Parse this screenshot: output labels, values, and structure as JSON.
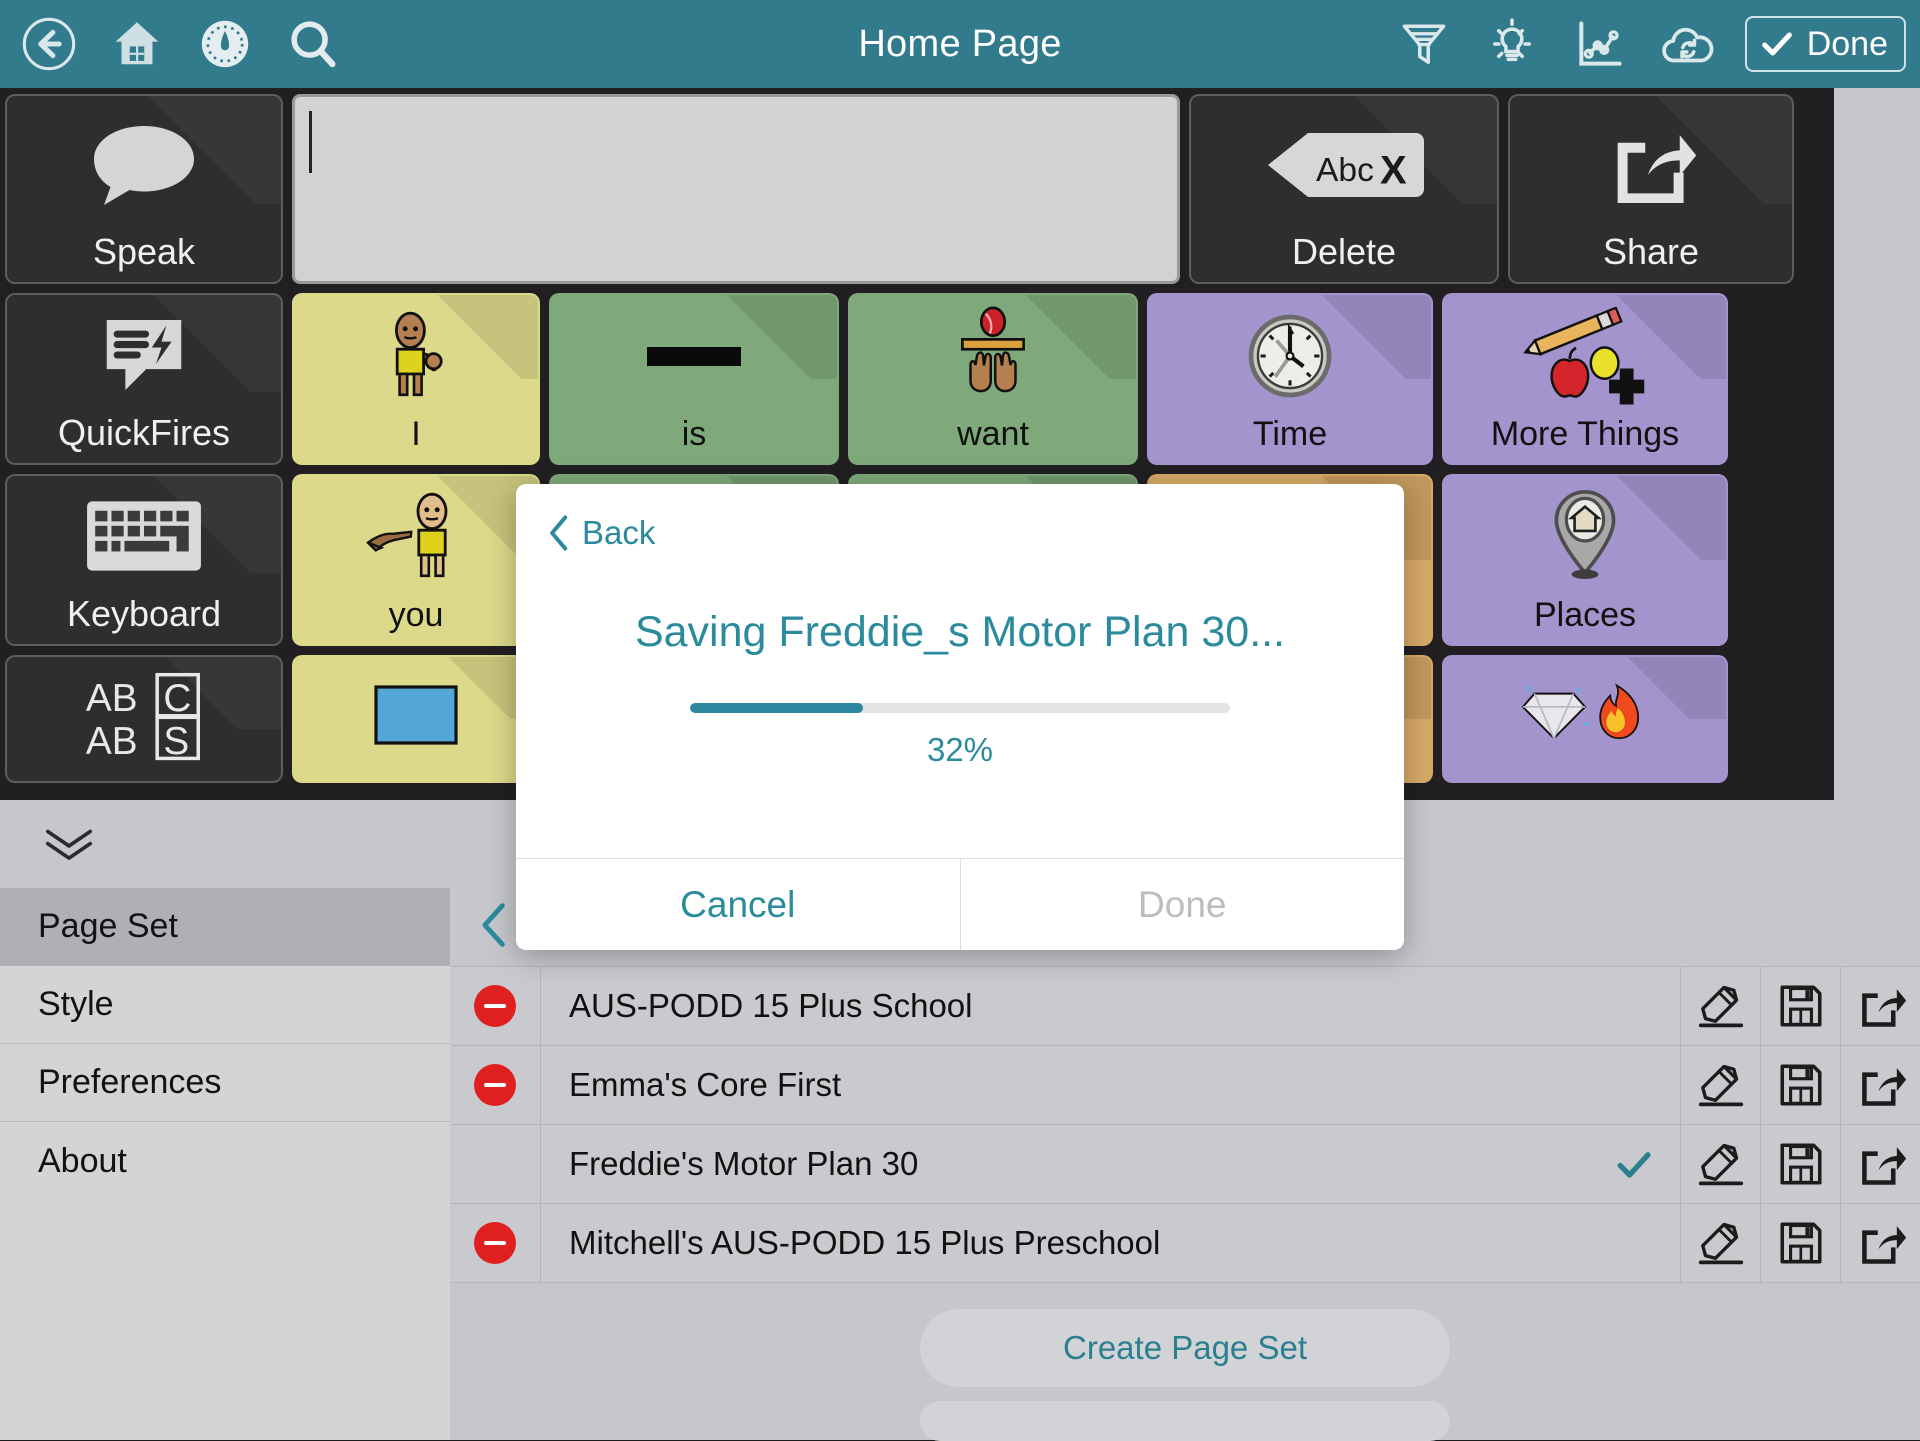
{
  "toolbar": {
    "title": "Home Page",
    "left_icons": [
      {
        "name": "back-icon",
        "label": "Back"
      },
      {
        "name": "home-icon",
        "label": "Home"
      },
      {
        "name": "gauge-icon",
        "label": "Dashboard"
      },
      {
        "name": "search-icon",
        "label": "Search"
      }
    ],
    "right_icons": [
      {
        "name": "filter-icon",
        "label": "Filter"
      },
      {
        "name": "lightbulb-icon",
        "label": "Hints"
      },
      {
        "name": "chart-icon",
        "label": "Analytics"
      },
      {
        "name": "cloud-sync-icon",
        "label": "Sync"
      }
    ],
    "done_label": "Done",
    "accent": "#317b8c"
  },
  "aac": {
    "message_bar": {
      "value": "",
      "placeholder": ""
    },
    "row1": [
      {
        "label": "Speak",
        "icon": "speech-bubble-icon",
        "style": "dark"
      },
      {
        "label": "Delete",
        "icon": "backspace-abc-icon",
        "style": "dark"
      },
      {
        "label": "Share",
        "icon": "share-export-icon",
        "style": "dark"
      }
    ],
    "row2": [
      {
        "label": "QuickFires",
        "icon": "quickfire-icon",
        "style": "dark"
      },
      {
        "label": "I",
        "icon": "person-self-icon",
        "style": "yellow"
      },
      {
        "label": "is",
        "icon": "black-bar-icon",
        "style": "green"
      },
      {
        "label": "want",
        "icon": "ball-hands-icon",
        "style": "green"
      },
      {
        "label": "Time",
        "icon": "clock-icon",
        "style": "purple"
      },
      {
        "label": "More Things",
        "icon": "pencil-apple-plus-icon",
        "style": "purple"
      }
    ],
    "row3": [
      {
        "label": "Keyboard",
        "icon": "keyboard-icon",
        "style": "dark"
      },
      {
        "label": "you",
        "icon": "person-pointing-icon",
        "style": "yellow"
      },
      {
        "label": "",
        "icon": "blank-icon",
        "style": "green"
      },
      {
        "label": "",
        "icon": "blank-icon",
        "style": "green"
      },
      {
        "label": "",
        "icon": "red-circle-icon",
        "style": "tan"
      },
      {
        "label": "Places",
        "icon": "map-pin-house-icon",
        "style": "purple"
      }
    ],
    "row4": [
      {
        "label": "ABC ABS",
        "icon": "abc-icon",
        "style": "dark"
      },
      {
        "label": "",
        "icon": "blue-square-icon",
        "style": "yellow"
      },
      {
        "label": "",
        "icon": "blank-icon",
        "style": "green"
      },
      {
        "label": "",
        "icon": "blank-icon",
        "style": "green"
      },
      {
        "label": "",
        "icon": "blank-icon",
        "style": "tan"
      },
      {
        "label": "",
        "icon": "gem-fire-icon",
        "style": "purple"
      }
    ]
  },
  "settings": {
    "sidebar": [
      {
        "label": "Page Set",
        "selected": true
      },
      {
        "label": "Style",
        "selected": false
      },
      {
        "label": "Preferences",
        "selected": false
      },
      {
        "label": "About",
        "selected": false
      }
    ],
    "page_sets": [
      {
        "name": "AUS-PODD 15 Plus School",
        "removable": true,
        "active": false
      },
      {
        "name": "Emma's Core First",
        "removable": true,
        "active": false
      },
      {
        "name": "Freddie's Motor Plan 30",
        "removable": false,
        "active": true
      },
      {
        "name": "Mitchell's AUS-PODD 15 Plus Preschool",
        "removable": true,
        "active": false
      }
    ],
    "row_actions": [
      {
        "name": "edit-icon",
        "label": "Edit"
      },
      {
        "name": "save-icon",
        "label": "Save"
      },
      {
        "name": "share-icon",
        "label": "Share"
      }
    ],
    "create_label": "Create Page Set"
  },
  "modal": {
    "back_label": "Back",
    "title": "Saving Freddie_s Motor Plan 30...",
    "progress_percent": 32,
    "progress_label": "32%",
    "cancel_label": "Cancel",
    "done_label": "Done",
    "accent": "#2b8b9c"
  }
}
